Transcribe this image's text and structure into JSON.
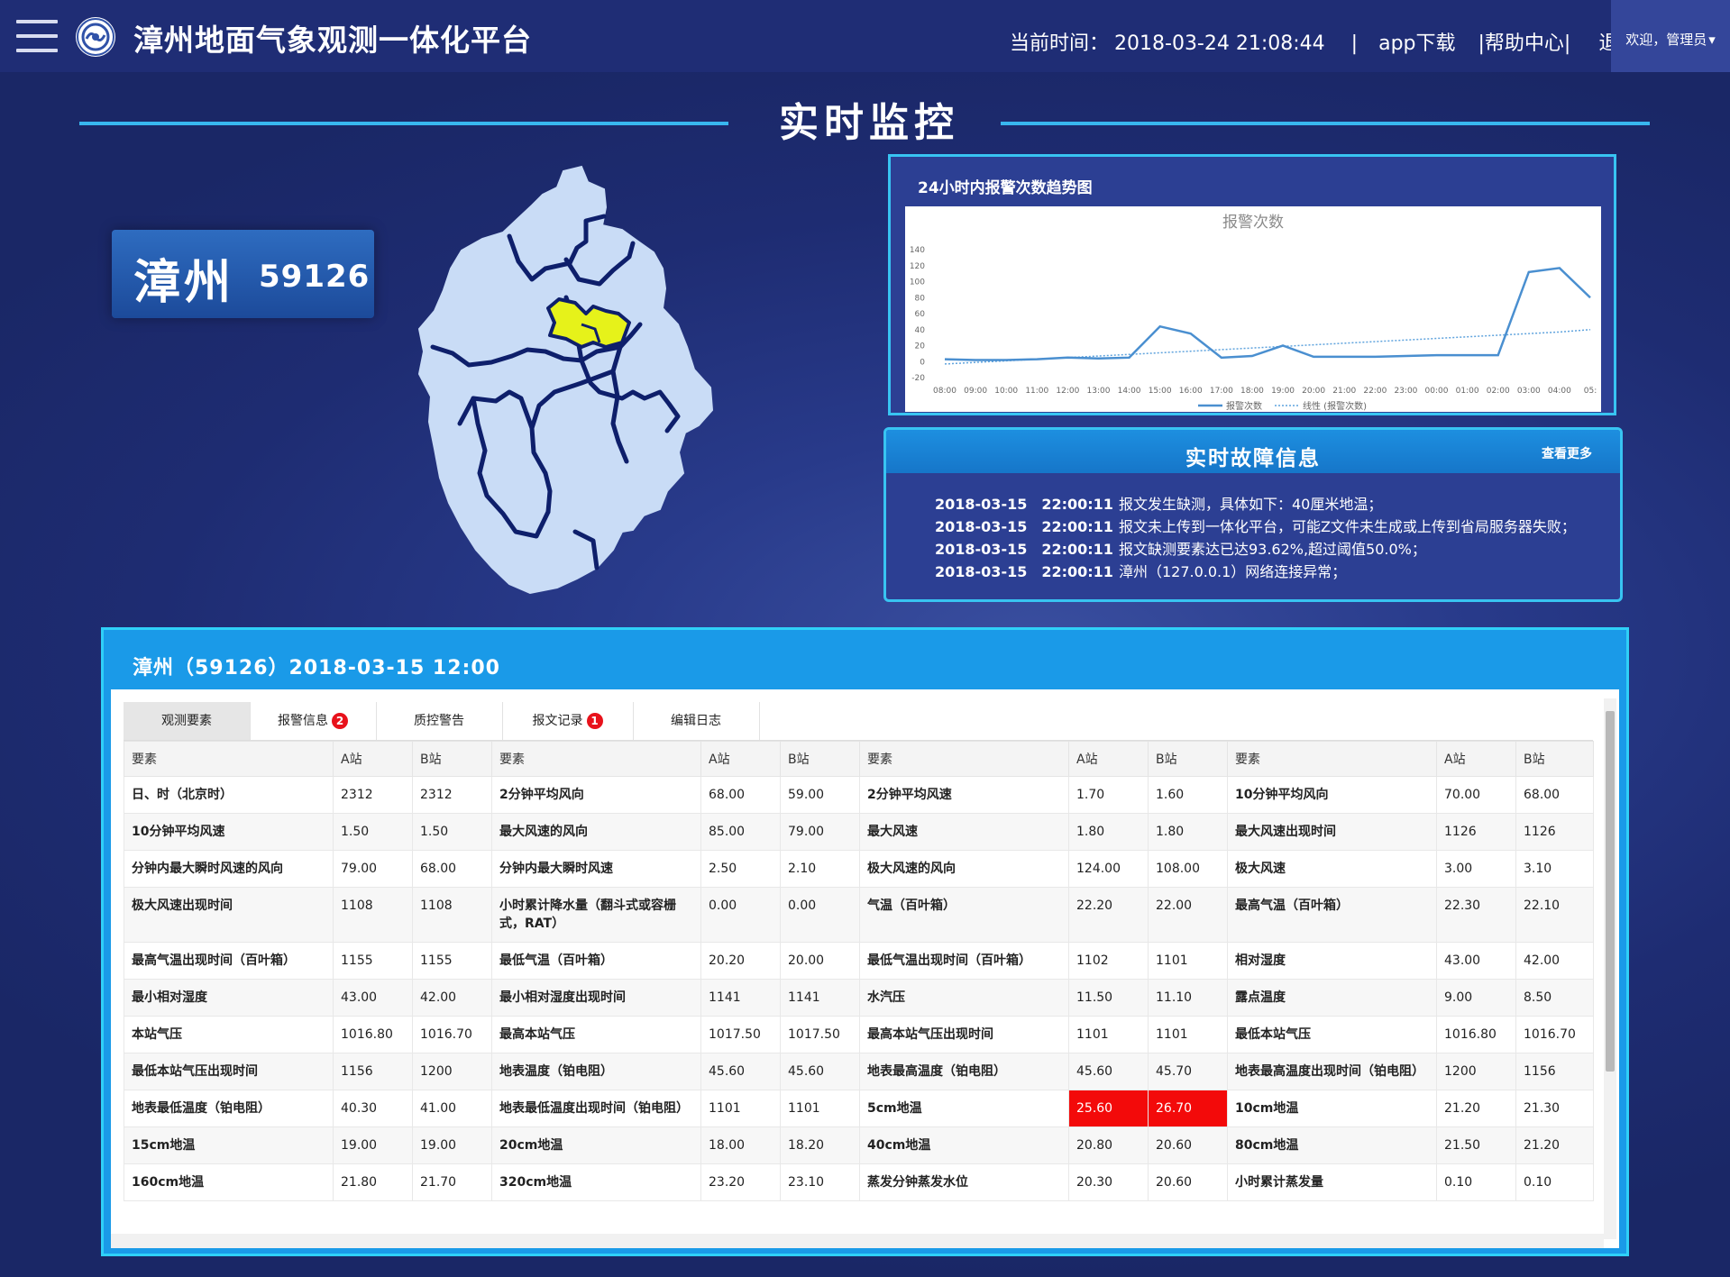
{
  "header": {
    "title": "漳州地面气象观测一体化平台",
    "time_label": "当前时间：",
    "time_value": "2018-03-24 21:08:44",
    "separator": "|",
    "app_download": "app下载",
    "help_center": "|帮助中心|",
    "logout": "退出",
    "welcome": "欢迎，管理员",
    "dropdown_glyph": "▾"
  },
  "page_title": "实时监控",
  "station": {
    "name": "漳州",
    "code": "59126"
  },
  "map": {
    "fill": "#c9dcf6",
    "border": "#0e1f6b",
    "highlight": "#e6f21a"
  },
  "chart_panel": {
    "title": "24小时内报警次数趋势图",
    "chart_data": {
      "type": "line",
      "title": "报警次数",
      "categories": [
        "08:00",
        "09:00",
        "10:00",
        "11:00",
        "12:00",
        "13:00",
        "14:00",
        "15:00",
        "16:00",
        "17:00",
        "18:00",
        "19:00",
        "20:00",
        "21:00",
        "22:00",
        "23:00",
        "00:00",
        "01:00",
        "02:00",
        "03:00",
        "04:00",
        "05:"
      ],
      "series": [
        {
          "name": "报警次数",
          "values": [
            3,
            2,
            2,
            3,
            5,
            4,
            5,
            44,
            35,
            5,
            7,
            20,
            6,
            6,
            6,
            7,
            8,
            8,
            8,
            112,
            117,
            80
          ]
        },
        {
          "name": "线性 (报警次数)",
          "values": [
            -3,
            -1,
            1,
            3,
            5,
            7,
            9,
            11,
            13,
            15,
            17,
            19,
            21,
            23,
            25,
            27,
            29,
            31,
            33,
            35,
            37,
            40
          ]
        }
      ],
      "ylim": [
        -20,
        140
      ],
      "yticks": [
        140,
        120,
        100,
        80,
        60,
        40,
        20,
        0,
        -20
      ],
      "grid": false,
      "legend": "bottom",
      "colors": {
        "line": "#4a8fd0",
        "trend": "#5fa3dd"
      }
    }
  },
  "fault_panel": {
    "title": "实时故障信息",
    "more": "查看更多",
    "items": [
      {
        "datetime": "2018-03-15　22:00:11",
        "text": "报文发生缺测，具体如下：40厘米地温；"
      },
      {
        "datetime": "2018-03-15　22:00:11",
        "text": "报文未上传到一体化平台，可能Z文件未生成或上传到省局服务器失败；"
      },
      {
        "datetime": "2018-03-15　22:00:11",
        "text": "报文缺测要素达已达93.62%,超过阈值50.0%；"
      },
      {
        "datetime": "2018-03-15　22:00:11",
        "text": "漳州（127.0.0.1）网络连接异常；"
      }
    ]
  },
  "table_panel": {
    "title": "漳州（59126）2018-03-15 12:00",
    "tabs": [
      {
        "label": "观测要素",
        "badge": ""
      },
      {
        "label": "报警信息",
        "badge": "2"
      },
      {
        "label": "质控警告",
        "badge": ""
      },
      {
        "label": "报文记录",
        "badge": "1"
      },
      {
        "label": "编辑日志",
        "badge": ""
      }
    ],
    "headers": [
      "要素",
      "A站",
      "B站",
      "要素",
      "A站",
      "B站",
      "要素",
      "A站",
      "B站",
      "要素",
      "A站",
      "B站"
    ],
    "rows": [
      [
        "日、时（北京时）",
        "2312",
        "2312",
        "2分钟平均风向",
        "68.00",
        "59.00",
        "2分钟平均风速",
        "1.70",
        "1.60",
        "10分钟平均风向",
        "70.00",
        "68.00"
      ],
      [
        "10分钟平均风速",
        "1.50",
        "1.50",
        "最大风速的风向",
        "85.00",
        "79.00",
        "最大风速",
        "1.80",
        "1.80",
        "最大风速出现时间",
        "1126",
        "1126"
      ],
      [
        "分钟内最大瞬时风速的风向",
        "79.00",
        "68.00",
        "分钟内最大瞬时风速",
        "2.50",
        "2.10",
        "极大风速的风向",
        "124.00",
        "108.00",
        "极大风速",
        "3.00",
        "3.10"
      ],
      [
        "极大风速出现时间",
        "1108",
        "1108",
        "小时累计降水量（翻斗式或容栅式，RAT）",
        "0.00",
        "0.00",
        "气温（百叶箱）",
        "22.20",
        "22.00",
        "最高气温（百叶箱）",
        "22.30",
        "22.10"
      ],
      [
        "最高气温出现时间（百叶箱）",
        "1155",
        "1155",
        "最低气温（百叶箱）",
        "20.20",
        "20.00",
        "最低气温出现时间（百叶箱）",
        "1102",
        "1101",
        "相对湿度",
        "43.00",
        "42.00"
      ],
      [
        "最小相对湿度",
        "43.00",
        "42.00",
        "最小相对湿度出现时间",
        "1141",
        "1141",
        "水汽压",
        "11.50",
        "11.10",
        "露点温度",
        "9.00",
        "8.50"
      ],
      [
        "本站气压",
        "1016.80",
        "1016.70",
        "最高本站气压",
        "1017.50",
        "1017.50",
        "最高本站气压出现时间",
        "1101",
        "1101",
        "最低本站气压",
        "1016.80",
        "1016.70"
      ],
      [
        "最低本站气压出现时间",
        "1156",
        "1200",
        "地表温度（铂电阻）",
        "45.60",
        "45.60",
        "地表最高温度（铂电阻）",
        "45.60",
        "45.70",
        "地表最高温度出现时间（铂电阻）",
        "1200",
        "1156"
      ],
      [
        "地表最低温度（铂电阻）",
        "40.30",
        "41.00",
        "地表最低温度出现时间（铂电阻）",
        "1101",
        "1101",
        "5cm地温",
        "25.60",
        "26.70",
        "10cm地温",
        "21.20",
        "21.30"
      ],
      [
        "15cm地温",
        "19.00",
        "19.00",
        "20cm地温",
        "18.00",
        "18.20",
        "40cm地温",
        "20.80",
        "20.60",
        "80cm地温",
        "21.50",
        "21.20"
      ],
      [
        "160cm地温",
        "21.80",
        "21.70",
        "320cm地温",
        "23.20",
        "23.10",
        "蒸发分钟蒸发水位",
        "20.30",
        "20.60",
        "小时累计蒸发量",
        "0.10",
        "0.10"
      ]
    ],
    "alarm_color": "#f30a0a"
  }
}
